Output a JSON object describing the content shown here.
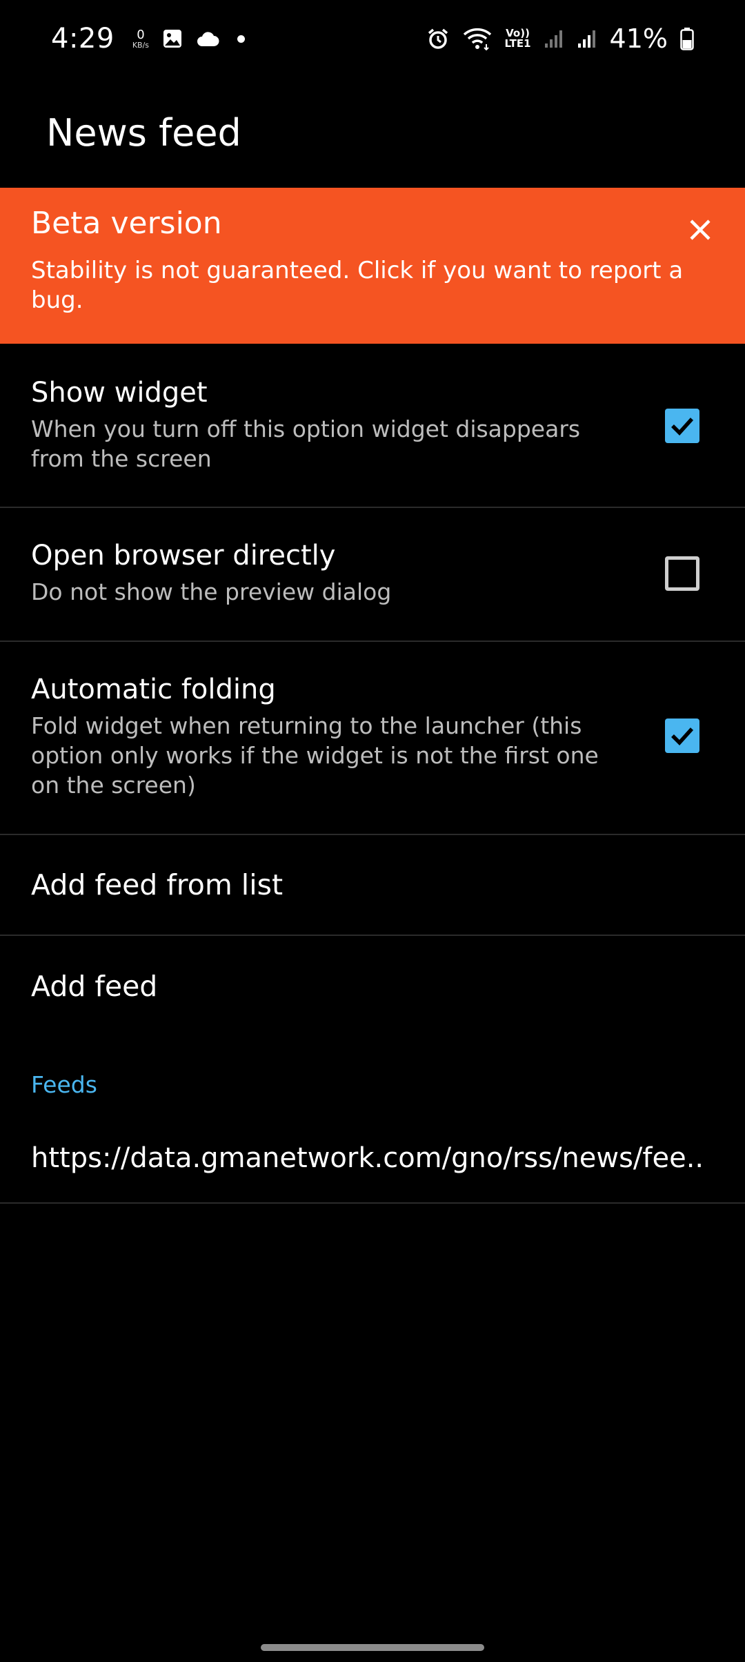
{
  "status_bar": {
    "time": "4:29",
    "net_speed_value": "0",
    "net_speed_unit": "KB/s",
    "lte_top": "Vo))",
    "lte_bottom": "LTE1",
    "battery": "41%"
  },
  "header": {
    "title": "News feed"
  },
  "beta_banner": {
    "title": "Beta version",
    "description": "Stability is not guaranteed. Click if you want to report a bug.",
    "color": "#f55422"
  },
  "settings": [
    {
      "title": "Show widget",
      "subtitle": "When you turn off this option widget disappears from the screen",
      "checked": true
    },
    {
      "title": "Open browser directly",
      "subtitle": "Do not show the preview dialog",
      "checked": false
    },
    {
      "title": "Automatic folding",
      "subtitle": "Fold widget when returning to the launcher (this option only works if the widget is not the first one on the screen)",
      "checked": true
    }
  ],
  "actions": {
    "add_from_list": "Add feed from list",
    "add_feed": "Add feed"
  },
  "feeds": {
    "section_label": "Feeds",
    "items": [
      "https://data.gmanetwork.com/gno/rss/news/fee.."
    ]
  },
  "colors": {
    "accent": "#4ab6f0",
    "banner": "#f55422",
    "background": "#000000"
  }
}
